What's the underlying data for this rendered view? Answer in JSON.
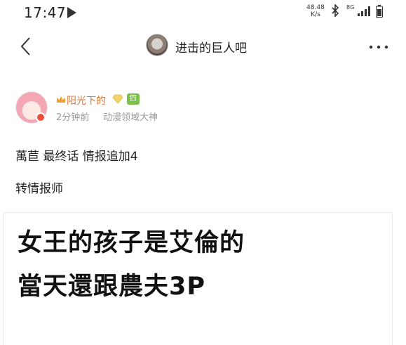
{
  "status_bar": {
    "time": "17:47",
    "net_speed_value": "48.48",
    "net_speed_unit": "K/s",
    "sim_label": "8G",
    "icons": [
      "play-icon",
      "bluetooth-icon",
      "signal-icon",
      "battery-icon"
    ]
  },
  "nav": {
    "title": "进击的巨人吧",
    "back_icon": "chevron-left-icon",
    "more_icon": "more-horizontal-icon"
  },
  "post": {
    "username": "阳光下的",
    "level": "四",
    "time_ago": "2分钟前",
    "user_rank": "动漫领域大神",
    "line1": "萬苣 最终话 情报追加4",
    "line2": "转情报师"
  },
  "image_card": {
    "line1": "女王的孩子是艾倫的",
    "line2": "當天還跟農夫3P"
  },
  "colors": {
    "username": "#e0783a",
    "level_badge": "#7cc04a",
    "meta_text": "#9a9a9a"
  }
}
